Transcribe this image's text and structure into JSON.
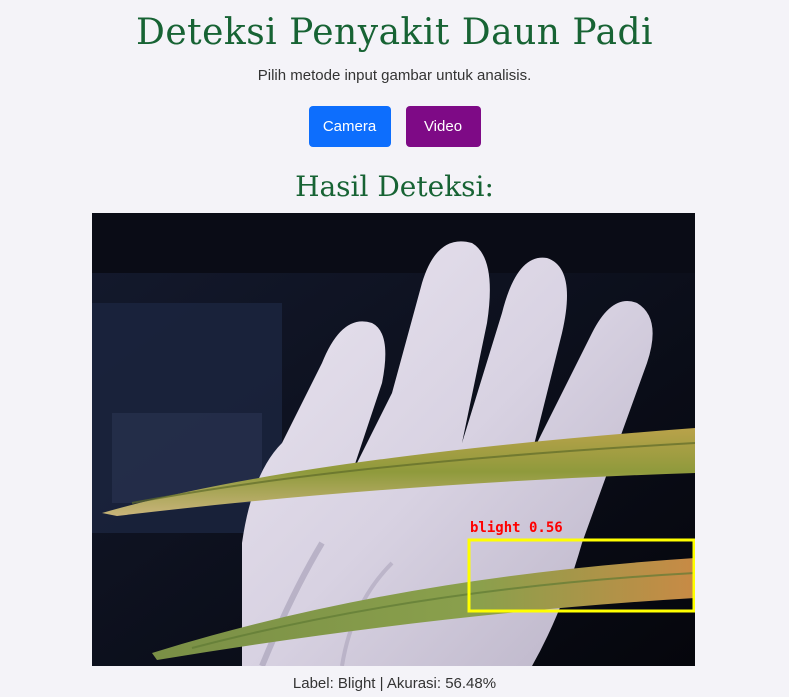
{
  "header": {
    "title": "Deteksi Penyakit Daun Padi",
    "subtitle": "Pilih metode input gambar untuk analisis."
  },
  "buttons": {
    "camera_label": "Camera",
    "video_label": "Video"
  },
  "result": {
    "heading": "Hasil Deteksi:",
    "detection_label": "blight 0.56",
    "caption": "Label: Blight | Akurasi: 56.48%"
  },
  "colors": {
    "title": "#176334",
    "camera_button": "#0d6efd",
    "video_button": "#7e0a86",
    "bbox": "#ffff00",
    "bbox_label": "#ff0000"
  }
}
